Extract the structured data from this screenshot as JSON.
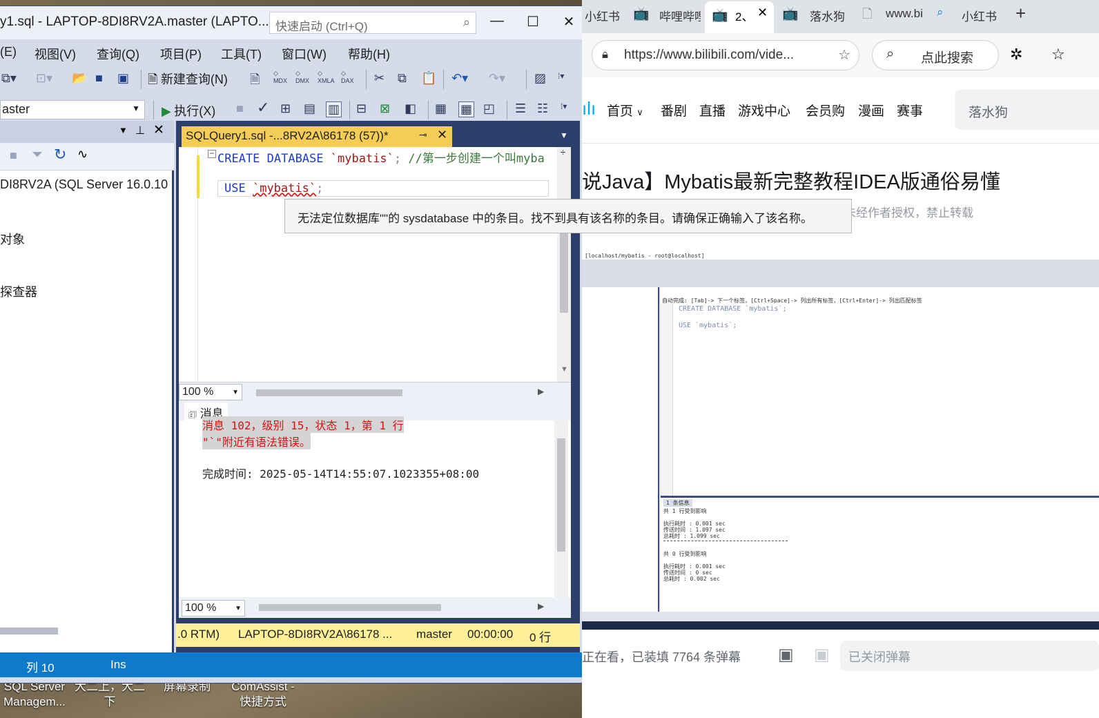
{
  "desktop": {
    "icons": [
      {
        "label": "SQL Server Managem..."
      },
      {
        "label": "大二上，大二下"
      },
      {
        "label": "屏幕录制"
      },
      {
        "label": "ComAssist - 快捷方式"
      }
    ]
  },
  "ssms": {
    "title": "y1.sql - LAPTOP-8DI8RV2A.master (LAPTO...",
    "quick_launch_placeholder": "快速启动 (Ctrl+Q)",
    "menu": [
      "(E)",
      "视图(V)",
      "查询(Q)",
      "项目(P)",
      "工具(T)",
      "窗口(W)",
      "帮助(H)"
    ],
    "toolbar": {
      "new_query": "新建查询(N)",
      "tb_mdx": "MDX",
      "tb_dmx": "DMX",
      "tb_xmla": "XMLA",
      "tb_dax": "DAX",
      "database": "aster",
      "execute": "执行(X)"
    },
    "object_explorer": {
      "server": "DI8RV2A (SQL Server 16.0.10",
      "items": [
        "对象",
        "探查器"
      ]
    },
    "doc_tab": "SQLQuery1.sql -...8RV2A\\86178 (57))*",
    "code": {
      "line1_kw": "CREATE DATABASE",
      "line1_name": "`mybatis`",
      "line1_rest": ";",
      "line1_comment": "//第一步创建一个叫myba",
      "line2_kw": "USE",
      "line2_name": "`mybatis`",
      "line2_rest": ";"
    },
    "tooltip": "无法定位数据库\"\"的 sysdatabase 中的条目。找不到具有该名称的条目。请确保正确输入了该名称。",
    "zoom": "100 %",
    "messages_tab": "消息",
    "messages": {
      "err1": "消息 102，级别 15，状态 1，第 1 行",
      "err2": "\"`\"附近有语法错误。",
      "done": "完成时间: 2025-05-14T14:55:07.1023355+08:00"
    },
    "status": {
      "version": ".0 RTM)",
      "server": "LAPTOP-8DI8RV2A\\86178 ...",
      "db": "master",
      "time": "00:00:00",
      "rows": "0 行"
    },
    "bottom": {
      "col": "列 10",
      "ins": "Ins"
    }
  },
  "browser": {
    "tabs": [
      "小红书",
      "哔哩哔哩",
      "2、",
      "落水狗",
      "www.bi",
      "小红书"
    ],
    "url": "https://www.bilibili.com/vide...",
    "search_placeholder": "点此搜索",
    "nav": [
      "首页",
      "番剧",
      "直播",
      "游戏中心",
      "会员购",
      "漫画",
      "赛事"
    ],
    "site_search": "落水狗",
    "video_title": "说Java】Mybatis最新完整教程IDEA版通俗易懂",
    "video_sub": "未经作者授权，禁止转载",
    "danmaku_count": "正在看，已装填 7764 条弹幕",
    "danmaku_input": "已关闭弹幕",
    "inner_video": {
      "window_title": "[localhost/mybatis - root@localhost]",
      "hint": "自动完成: [Tab]-> 下一个标签，[Ctrl+Space]-> 列出所有标签，[Ctrl+Enter]-> 列出匹配标签",
      "line1": "CREATE DATABASE `mybatis`;",
      "line3": "USE `mybatis`;",
      "result_tab": "1 条信息",
      "r1": "共 1 行受到影响",
      "r2": "执行耗时    : 0.001 sec",
      "r3": "传送时间    : 1.097 sec",
      "r4": "总耗时      : 1.099 sec",
      "r5": "共 0 行受到影响",
      "r6": "执行耗时    : 0.001 sec",
      "r7": "传送时间    : 0 sec",
      "r8": "总耗时      : 0.002 sec"
    }
  }
}
